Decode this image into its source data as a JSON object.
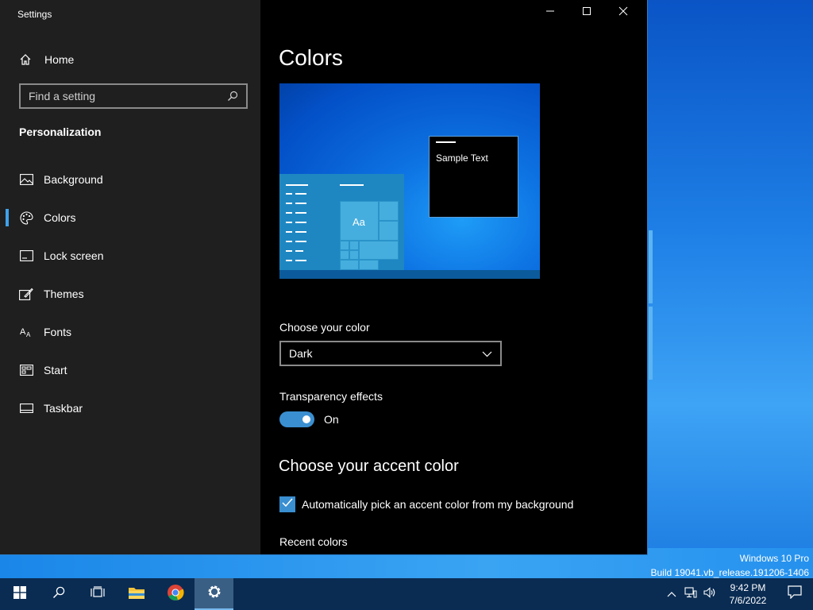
{
  "window": {
    "title": "Settings",
    "minimize_icon": "minimize-icon",
    "maximize_icon": "maximize-icon",
    "close_icon": "close-icon"
  },
  "sidebar": {
    "home_label": "Home",
    "search_placeholder": "Find a setting",
    "section_title": "Personalization",
    "items": [
      {
        "label": "Background",
        "icon": "image-icon"
      },
      {
        "label": "Colors",
        "icon": "palette-icon",
        "active": true
      },
      {
        "label": "Lock screen",
        "icon": "lock-screen-icon"
      },
      {
        "label": "Themes",
        "icon": "themes-icon"
      },
      {
        "label": "Fonts",
        "icon": "fonts-icon"
      },
      {
        "label": "Start",
        "icon": "start-icon"
      },
      {
        "label": "Taskbar",
        "icon": "taskbar-icon"
      }
    ]
  },
  "main": {
    "title": "Colors",
    "preview": {
      "sample_text": "Sample Text",
      "tile_text": "Aa"
    },
    "choose_color_label": "Choose your color",
    "choose_color_value": "Dark",
    "transparency_label": "Transparency effects",
    "transparency_state": "On",
    "accent_heading": "Choose your accent color",
    "auto_accent_label": "Automatically pick an accent color from my background",
    "recent_colors_label": "Recent colors"
  },
  "desktop": {
    "edition": "Windows 10 Pro",
    "build": "Build 19041.vb_release.191206-1406"
  },
  "taskbar": {
    "time": "9:42 PM",
    "date": "7/6/2022"
  },
  "colors": {
    "accent": "#3a8fd1",
    "sidebar_bg": "#1f1f1f",
    "content_bg": "#000000",
    "taskbar_bg": "#0a2c53"
  }
}
